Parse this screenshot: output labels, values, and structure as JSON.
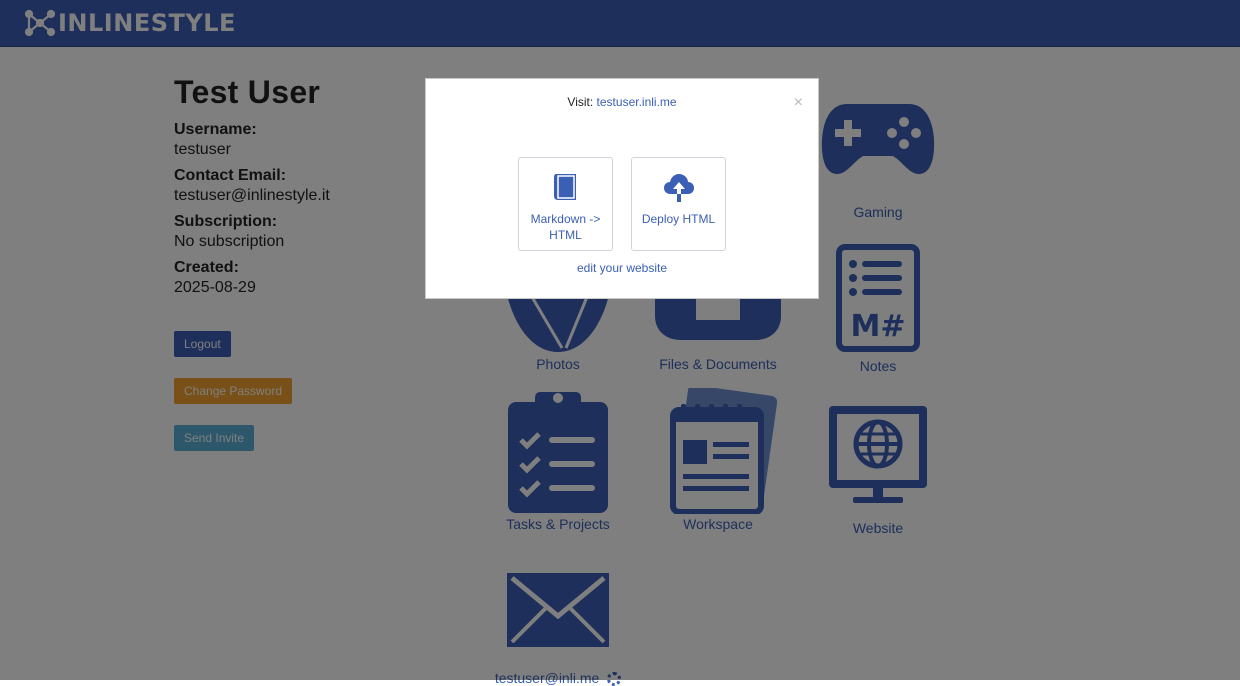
{
  "brand": {
    "name": "INLINESTYLE"
  },
  "profile": {
    "name": "Test User",
    "username_label": "Username:",
    "username": "testuser",
    "email_label": "Contact Email:",
    "email": "testuser@inlinestyle.it",
    "subscription_label": "Subscription:",
    "subscription": "No subscription",
    "created_label": "Created:",
    "created": "2025-08-29"
  },
  "buttons": {
    "logout": "Logout",
    "change_password": "Change Password",
    "send_invite": "Send Invite"
  },
  "apps": {
    "gaming": "Gaming",
    "photos": "Photos",
    "files": "Files & Documents",
    "notes": "Notes",
    "tasks": "Tasks & Projects",
    "workspace": "Workspace",
    "website": "Website",
    "mail": "testuser@inli.me"
  },
  "modal": {
    "visit_prefix": "Visit:",
    "visit_link": "testuser.inli.me",
    "close": "×",
    "option_markdown": "Markdown -> HTML",
    "option_deploy": "Deploy HTML",
    "edit_link": "edit your website"
  },
  "colors": {
    "accent": "#3a5fb4",
    "warning": "#f0a030",
    "info": "#5bb0d6",
    "overlay": "rgba(0,0,0,0.5)"
  }
}
